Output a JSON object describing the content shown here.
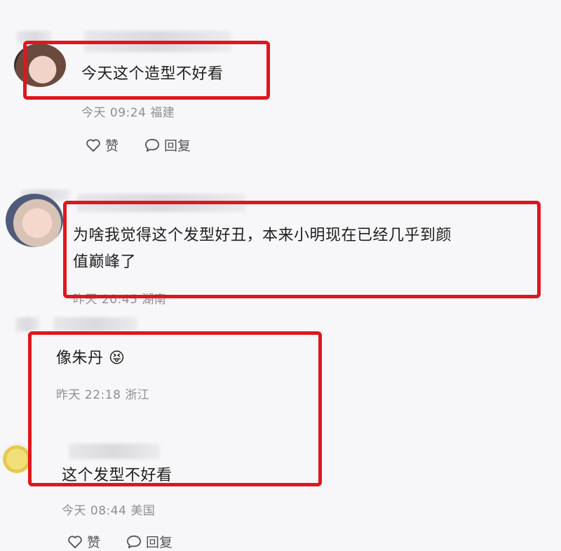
{
  "comments": [
    {
      "text": "今天这个造型不好看",
      "time": "今天 09:24",
      "location": "福建",
      "like_label": "赞",
      "reply_label": "回复"
    },
    {
      "text_line1": "为啥我觉得这个发型好丑，本来小明现在已经几乎到颜",
      "text_line2": "值巅峰了",
      "time": "昨天 20:45",
      "location": "湖南"
    },
    {
      "text": "像朱丹",
      "emoji": "😝",
      "time": "昨天 22:18",
      "location": "浙江"
    },
    {
      "text": "这个发型不好看",
      "time": "今天 08:44",
      "location": "美国",
      "like_label": "赞",
      "reply_label": "回复"
    }
  ],
  "colors": {
    "highlight_box": "#e0161d",
    "meta_text": "#8e8e93",
    "background": "#f7f7f9"
  },
  "icons": [
    "heart-outline-icon",
    "comment-bubble-icon"
  ]
}
